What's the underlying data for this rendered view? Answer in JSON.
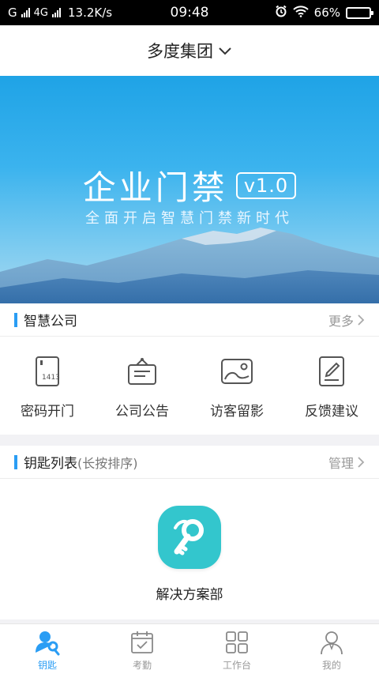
{
  "status_bar": {
    "carrier_signal": "G",
    "network": "4G",
    "speed": "13.2K/s",
    "time": "09:48",
    "battery": "66%",
    "battery_level": 0.66,
    "icons": [
      "alarm-icon",
      "wifi-icon",
      "battery-icon"
    ]
  },
  "header": {
    "company": "多度集团",
    "dropdown_icon": "chevron-down-icon"
  },
  "banner": {
    "title": "企业门禁",
    "version": "v1.0",
    "subtitle": "全面开启智慧门禁新时代"
  },
  "smart_company": {
    "title": "智慧公司",
    "more_label": "更多",
    "items": [
      {
        "label": "密码开门",
        "icon": "password-door-icon"
      },
      {
        "label": "公司公告",
        "icon": "announcement-icon"
      },
      {
        "label": "访客留影",
        "icon": "visitor-photo-icon"
      },
      {
        "label": "反馈建议",
        "icon": "feedback-icon"
      }
    ]
  },
  "key_list": {
    "title": "钥匙列表",
    "hint": "(长按排序)",
    "manage_label": "管理",
    "keys": [
      {
        "label": "解决方案部",
        "icon": "key-icon",
        "color": "#33c6cd"
      }
    ]
  },
  "bottom_nav": {
    "active_color": "#2a9df4",
    "items": [
      {
        "label": "钥匙",
        "icon": "key-people-icon",
        "active": true
      },
      {
        "label": "考勤",
        "icon": "calendar-check-icon",
        "active": false
      },
      {
        "label": "工作台",
        "icon": "grid-icon",
        "active": false
      },
      {
        "label": "我的",
        "icon": "user-icon",
        "active": false
      }
    ]
  }
}
